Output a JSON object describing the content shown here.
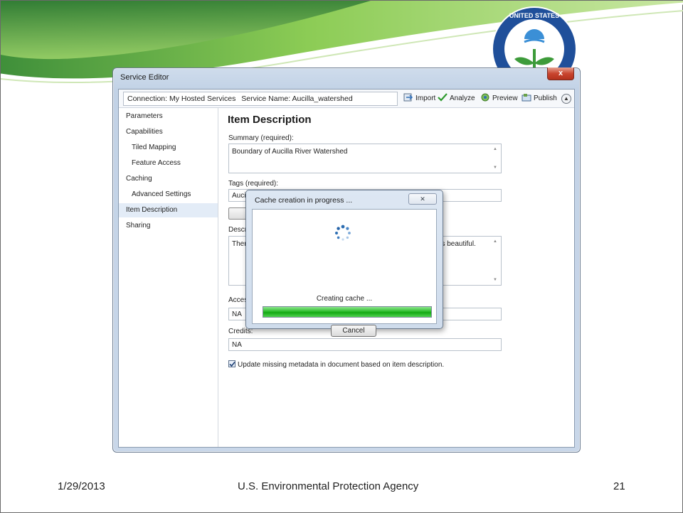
{
  "window": {
    "title": "Service Editor",
    "close_label": "x"
  },
  "toolbar": {
    "connection": "Connection: My Hosted Services",
    "service_name": "Service Name: Aucilla_watershed",
    "import_label": "Import",
    "analyze_label": "Analyze",
    "preview_label": "Preview",
    "publish_label": "Publish"
  },
  "nav": {
    "items": [
      {
        "label": "Parameters"
      },
      {
        "label": "Capabilities"
      },
      {
        "label": "Tiled Mapping"
      },
      {
        "label": "Feature Access"
      },
      {
        "label": "Caching"
      },
      {
        "label": "Advanced Settings"
      },
      {
        "label": "Item Description"
      },
      {
        "label": "Sharing"
      }
    ],
    "selected": "Item Description"
  },
  "main": {
    "title": "Item Description",
    "summary_label": "Summary (required):",
    "summary_value": "Boundary of Aucilla River Watershed",
    "tags_label": "Tags (required):",
    "tags_value": "Aucill",
    "description_label": "Descri",
    "description_value_start": "There",
    "description_value_end": ", it's beautiful.",
    "access_label": "Acces",
    "access_value": "NA",
    "credits_label": "Credits:",
    "credits_value": "NA",
    "metadata_checkbox_label": "Update missing metadata in document based on item description.",
    "metadata_checked": true
  },
  "dialog": {
    "title": "Cache creation in progress ...",
    "status": "Creating cache ...",
    "progress": 1.0,
    "cancel_label": "Cancel"
  },
  "footer": {
    "date": "1/29/2013",
    "agency": "U.S. Environmental Protection Agency",
    "page_number": "21"
  },
  "colors": {
    "accent_green": "#2ebd2e",
    "window_chrome": "#c9d7e9",
    "close_red": "#c9452f"
  }
}
